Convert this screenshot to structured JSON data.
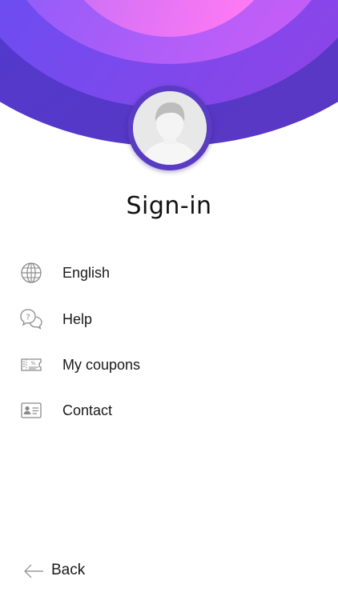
{
  "header": {
    "title": "Sign-in",
    "colors": {
      "outer": "#4a3bd0",
      "middle": "#6248f2",
      "inner": "#9d52f8",
      "core": "#f07cf7"
    }
  },
  "avatar": {
    "icon": "default-user-avatar",
    "ring_color": "#5a3bc4"
  },
  "menu": {
    "items": [
      {
        "label": "English",
        "icon": "globe-icon"
      },
      {
        "label": "Help",
        "icon": "help-chat-icon"
      },
      {
        "label": "My coupons",
        "icon": "coupon-icon"
      },
      {
        "label": "Contact",
        "icon": "contact-card-icon"
      }
    ]
  },
  "footer": {
    "back_label": "Back",
    "back_icon": "arrow-left-icon"
  }
}
